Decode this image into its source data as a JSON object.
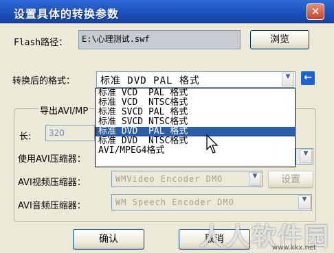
{
  "window": {
    "title": "设置具体的转换参数",
    "close_label": "×"
  },
  "flash": {
    "label": "Flash路径：",
    "path": "E:\\心理测试.swf",
    "browse_label": "浏览"
  },
  "format": {
    "label": "转换后的格式：",
    "selected": "标准 DVD  PAL 格式",
    "back_icon": "left-arrow-icon"
  },
  "dropdown": {
    "options": [
      "标准 VCD  PAL 格式",
      "标准 VCD  NTSC格式",
      "标准 SVCD PAL 格式",
      "标准 SVCD NTSC格式",
      "标准 DVD  PAL 格式",
      "标准 DVD  NTSC格式",
      "AVI/MPEG4格式"
    ],
    "selected_index": 4
  },
  "avi_group": {
    "title": "导出AVI/MP",
    "length_label": "长:",
    "length_value": "320",
    "compressor_label": "使用AVI压缩器：",
    "video_label": "AVI视频压缩器：",
    "video_value": "WMVideo Encoder DMO",
    "settings_label": "设置",
    "audio_label": "AVI音频压缩器：",
    "audio_value": "WM Speech Encoder DMO"
  },
  "buttons": {
    "ok_label": "确认",
    "cancel_label": "取消"
  },
  "watermark": {
    "text": "人人软件园",
    "url": "www.kkx.net"
  }
}
